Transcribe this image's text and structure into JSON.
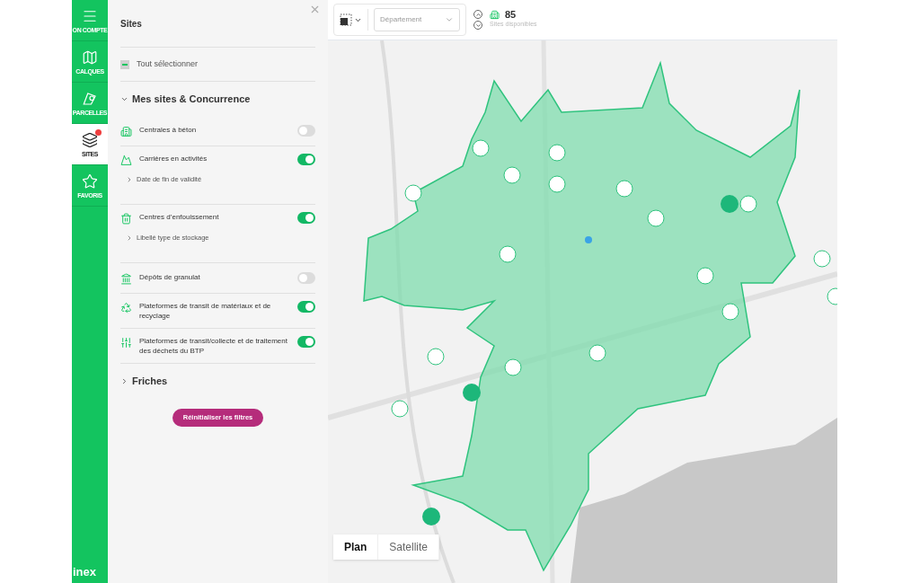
{
  "rail": {
    "items": [
      {
        "kind": "menu",
        "label": "ON COMPTE",
        "selected": false,
        "badge": false
      },
      {
        "kind": "map",
        "label": "CALQUES",
        "selected": false,
        "badge": false
      },
      {
        "kind": "parcel",
        "label": "PARCELLES",
        "selected": false,
        "badge": false
      },
      {
        "kind": "layers",
        "label": "SITES",
        "selected": true,
        "badge": true
      },
      {
        "kind": "star",
        "label": "FAVORIS",
        "selected": false,
        "badge": false
      }
    ],
    "logo": "inex"
  },
  "panel": {
    "title": "Sites",
    "select_all": {
      "label": "Tout sélectionner",
      "partial": true
    },
    "sections": [
      {
        "title": "Mes sites & Concurrence",
        "expanded": true,
        "items": [
          {
            "kind": "plant",
            "label": "Centrales à béton",
            "on": false
          },
          {
            "kind": "quarry",
            "label": "Carrières en activités",
            "on": true,
            "sub": "Date de fin de validité"
          },
          {
            "kind": "landfill",
            "label": "Centres d’enfouissement",
            "on": true,
            "sub": "Libellé type de stockage"
          },
          {
            "kind": "depot",
            "label": "Dépôts de granulat",
            "on": false
          },
          {
            "kind": "recycling",
            "label": "Plateformes de transit de matériaux et de recyclage",
            "on": true
          },
          {
            "kind": "sorting",
            "label": "Plateformes de transit/collecte et de traitement des déchets du BTP",
            "on": true
          }
        ]
      },
      {
        "title": "Friches",
        "expanded": false
      }
    ],
    "reset_button": "Réinitialiser les filtres"
  },
  "toolbar": {
    "department": {
      "placeholder": "Département"
    },
    "count": "85",
    "count_label": "Sites disponibles"
  },
  "map_type": [
    {
      "label": "Plan",
      "selected": true
    },
    {
      "label": "Satellite",
      "selected": false
    }
  ]
}
